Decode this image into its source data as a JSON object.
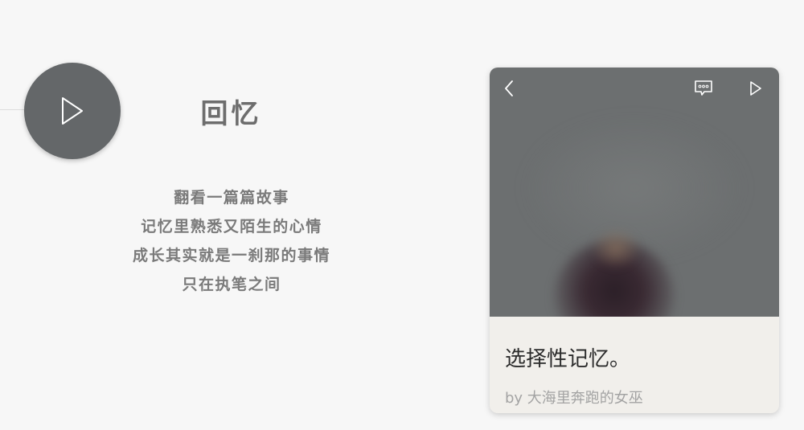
{
  "section": {
    "title": "回忆",
    "poem_lines": [
      "翻看一篇篇故事",
      "记忆里熟悉又陌生的心情",
      "成长其实就是一刹那的事情",
      "只在执笔之间"
    ],
    "play_icon": "play-icon"
  },
  "card": {
    "title": "选择性记忆。",
    "author": "by 大海里奔跑的女巫",
    "icons": {
      "back": "chevron-left-icon",
      "comment": "comment-bubble-icon",
      "forward": "play-icon"
    }
  },
  "colors": {
    "background": "#f7f7f7",
    "circle": "#646769",
    "image_overlay": "#6c6f70",
    "card_caption_bg": "#f1efeb",
    "title_text": "#6d6d6d"
  }
}
